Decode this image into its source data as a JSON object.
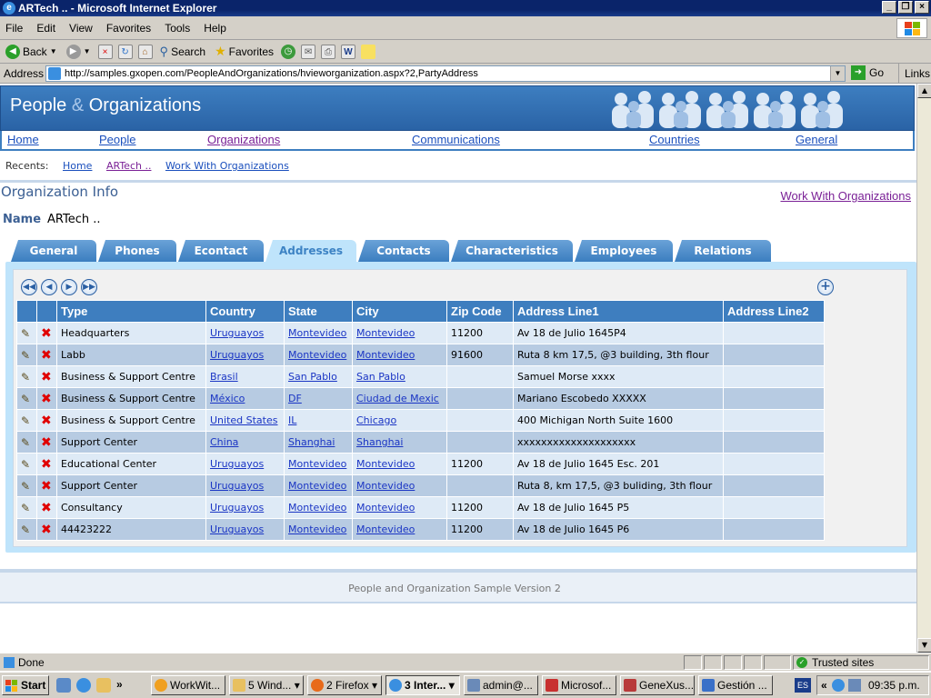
{
  "window": {
    "title": "ARTech .. - Microsoft Internet Explorer"
  },
  "menu": [
    "File",
    "Edit",
    "View",
    "Favorites",
    "Tools",
    "Help"
  ],
  "toolbar": {
    "back": "Back",
    "search": "Search",
    "favorites": "Favorites"
  },
  "address": {
    "label": "Address",
    "url": "http://samples.gxopen.com/PeopleAndOrganizations/hvieworganization.aspx?2,PartyAddress",
    "go": "Go",
    "links": "Links"
  },
  "site": {
    "title_a": "People ",
    "title_amp": "&",
    "title_b": " Organizations",
    "nav": [
      "Home",
      "People",
      "Organizations",
      "Communications",
      "Countries",
      "General"
    ],
    "recents_label": "Recents:",
    "recents": [
      "Home",
      "ARTech ..",
      "Work With Organizations"
    ],
    "section_title": "Organization Info",
    "work_with_link": "Work With Organizations",
    "name_label": "Name",
    "name_value": "ARTech .."
  },
  "tabs": [
    "General",
    "Phones",
    "Econtact",
    "Addresses",
    "Contacts",
    "Characteristics",
    "Employees",
    "Relations"
  ],
  "active_tab": "Addresses",
  "grid": {
    "columns": [
      "Type",
      "Country",
      "State",
      "City",
      "Zip Code",
      "Address Line1",
      "Address Line2"
    ],
    "rows": [
      {
        "type": "Headquarters",
        "country": "Uruguayos",
        "state": "Montevideo",
        "city": "Montevideo",
        "zip": "11200",
        "line1": "Av 18 de Julio 1645P4",
        "line2": ""
      },
      {
        "type": "Labb",
        "country": "Uruguayos",
        "state": "Montevideo",
        "city": "Montevideo",
        "zip": "91600",
        "line1": "Ruta 8 km 17,5, @3 building, 3th flour",
        "line2": ""
      },
      {
        "type": "Business & Support Centre",
        "country": "Brasil",
        "state": "San Pablo",
        "city": "San Pablo",
        "zip": "",
        "line1": "Samuel Morse xxxx",
        "line2": ""
      },
      {
        "type": "Business & Support Centre",
        "country": "México",
        "state": "DF",
        "city": "Ciudad de Mexic",
        "zip": "",
        "line1": "Mariano Escobedo XXXXX",
        "line2": ""
      },
      {
        "type": "Business & Support Centre",
        "country": "United States",
        "state": "IL",
        "city": "Chicago",
        "zip": "",
        "line1": "400 Michigan North Suite 1600",
        "line2": ""
      },
      {
        "type": "Support Center",
        "country": "China",
        "state": "Shanghai",
        "city": "Shanghai",
        "zip": "",
        "line1": "xxxxxxxxxxxxxxxxxxxx",
        "line2": ""
      },
      {
        "type": "Educational Center",
        "country": "Uruguayos",
        "state": "Montevideo",
        "city": "Montevideo",
        "zip": "11200",
        "line1": "Av 18 de Julio 1645 Esc. 201",
        "line2": ""
      },
      {
        "type": "Support Center",
        "country": "Uruguayos",
        "state": "Montevideo",
        "city": "Montevideo",
        "zip": "",
        "line1": "Ruta 8, km 17,5, @3 buliding, 3th flour",
        "line2": ""
      },
      {
        "type": "Consultancy",
        "country": "Uruguayos",
        "state": "Montevideo",
        "city": "Montevideo",
        "zip": "11200",
        "line1": "Av 18 de Julio 1645 P5",
        "line2": ""
      },
      {
        "type": "44423222",
        "country": "Uruguayos",
        "state": "Montevideo",
        "city": "Montevideo",
        "zip": "11200",
        "line1": "Av 18 de Julio 1645 P6",
        "line2": ""
      }
    ]
  },
  "footer": "People and Organization Sample Version 2",
  "status": {
    "text": "Done",
    "zone": "Trusted sites"
  },
  "taskbar": {
    "start": "Start",
    "tasks": [
      "WorkWit...",
      "5 Wind...",
      "2 Firefox",
      "3 Inter...",
      "admin@...",
      "Microsof...",
      "GeneXus...",
      "Gestión ..."
    ],
    "lang": "ES",
    "clock": "09:35 p.m."
  },
  "colors": {
    "accent": "#3e7ebf",
    "tab_active_bg": "#bfe4fb",
    "row_light": "#deeaf6",
    "row_dark": "#b7cbe2"
  }
}
